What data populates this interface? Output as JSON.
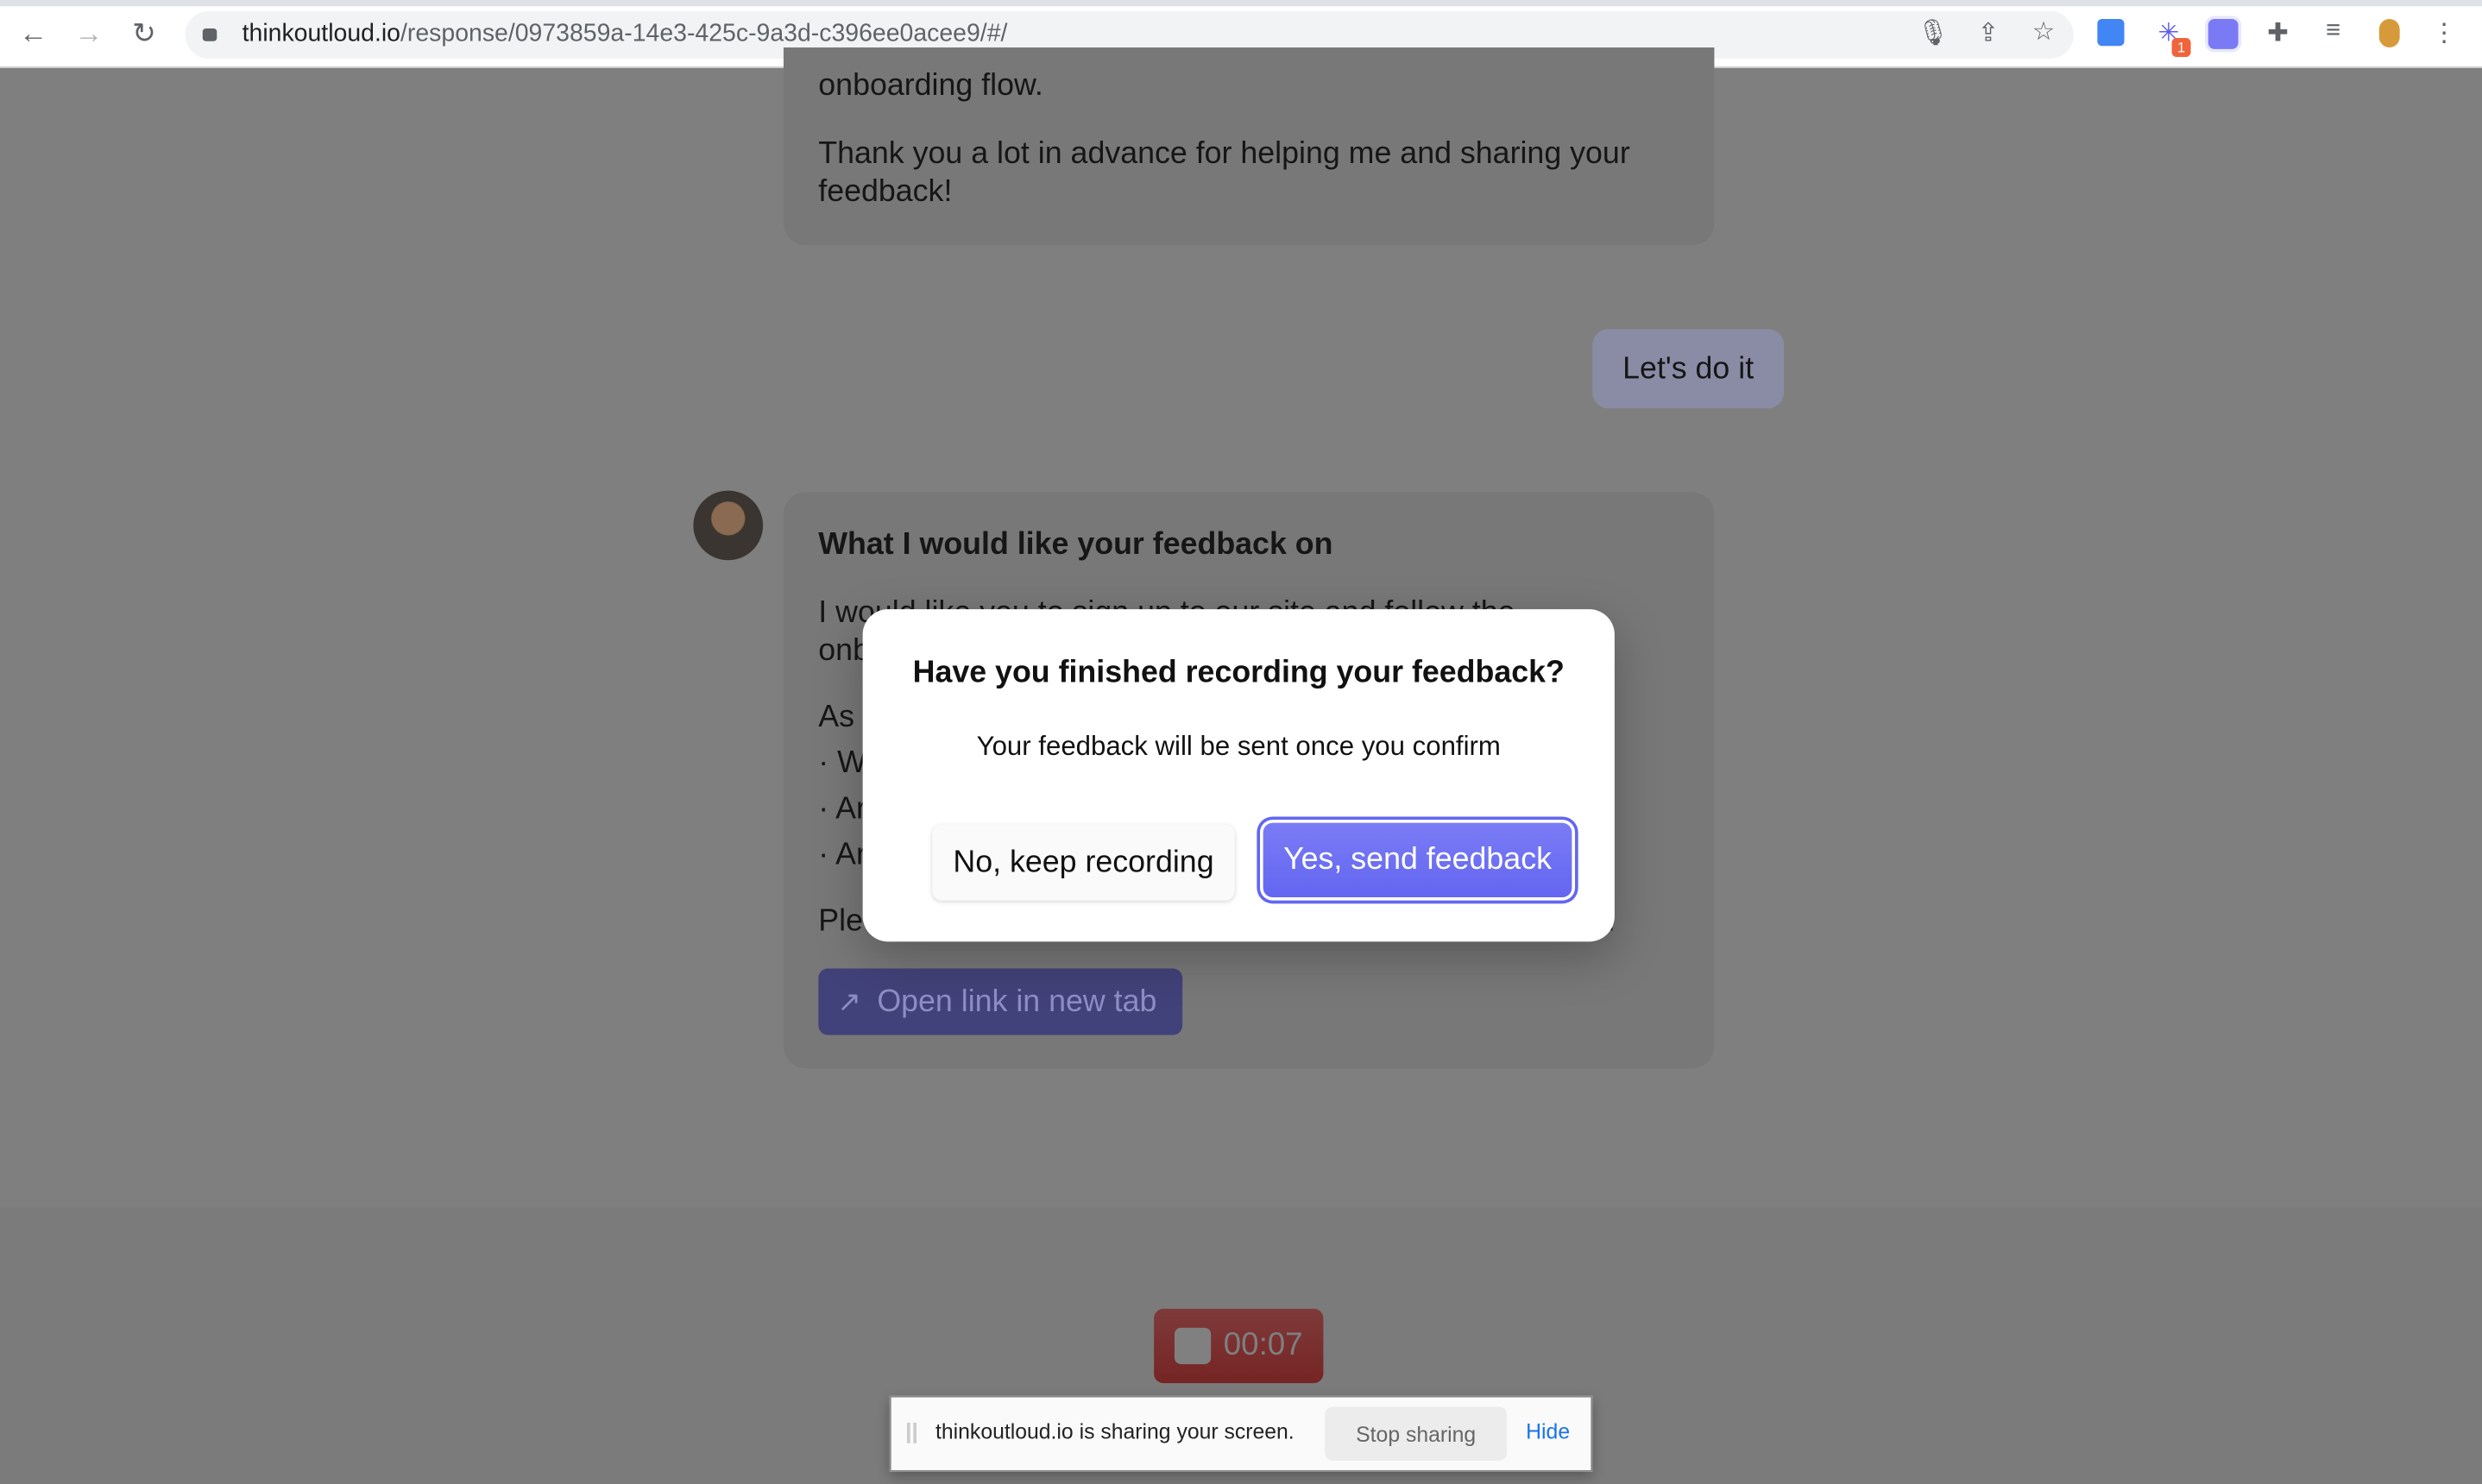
{
  "browser": {
    "url_host": "thinkoutloud.io",
    "url_path": "/response/0973859a-14e3-425c-9a3d-c396ee0acee9/#/",
    "icons": [
      "back-icon",
      "forward-icon",
      "reload-icon",
      "lock-icon",
      "microphone-icon",
      "share-icon",
      "star-icon",
      "google-translate-icon",
      "extension-icon",
      "extension-icon",
      "puzzle-icon",
      "reading-list-icon",
      "profile-avatar",
      "more-icon"
    ],
    "extension_badge": "1"
  },
  "chat": {
    "card1": {
      "lines": [
        "onboarding flow.",
        "Thank you a lot in advance for helping me and sharing your",
        "feedback!"
      ]
    },
    "user_reply": "Let's do it",
    "card2": {
      "heading": "What I would like your feedback on",
      "line1": "I would like you to sign up to our site and follow the",
      "fragments": [
        "onb",
        "As",
        "· W",
        "· Ar",
        "· Ar",
        "Ple",
        "!"
      ],
      "open_link": "Open link in new tab"
    }
  },
  "modal": {
    "title": "Have you finished recording your feedback?",
    "subtitle": "Your feedback will be sent once you confirm",
    "cancel": "No, keep recording",
    "confirm": "Yes, send feedback",
    "accent": "#6366f1"
  },
  "recorder": {
    "time": "00:07",
    "color": "#7a2a2a"
  },
  "share_bar": {
    "message": "thinkoutloud.io is sharing your screen.",
    "stop": "Stop sharing",
    "hide": "Hide"
  }
}
